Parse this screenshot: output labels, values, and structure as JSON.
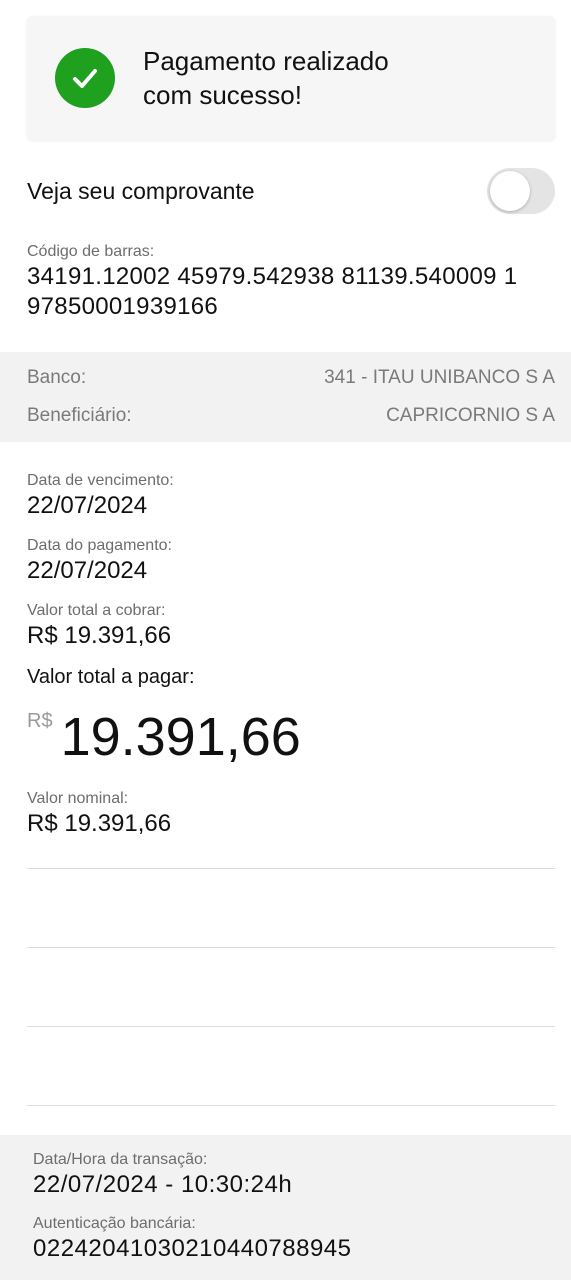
{
  "status": {
    "message": "Pagamento realizado com sucesso!",
    "icon": "check-icon",
    "color": "#1fa01f"
  },
  "receipt": {
    "label": "Veja seu comprovante",
    "toggle_on": false
  },
  "barcode": {
    "label": "Código de barras:",
    "value": "34191.12002 45979.542938 81139.540009 1 97850001939166"
  },
  "bank_info": {
    "bank_label": "Banco:",
    "bank_value": "341 - ITAU UNIBANCO S A",
    "beneficiary_label": "Beneficiário:",
    "beneficiary_value": "CAPRICORNIO S A"
  },
  "details": {
    "due_date_label": "Data de vencimento:",
    "due_date": "22/07/2024",
    "payment_date_label": "Data do pagamento:",
    "payment_date": "22/07/2024",
    "total_charge_label": "Valor total a cobrar:",
    "total_charge": "R$  19.391,66",
    "total_pay_label": "Valor total a pagar:",
    "total_pay_currency": "R$",
    "total_pay_amount": "19.391,66",
    "nominal_label": "Valor nominal:",
    "nominal_value": "R$  19.391,66"
  },
  "transaction": {
    "datetime_label": "Data/Hora da transação:",
    "datetime_value": "22/07/2024 - 10:30:24h",
    "auth_label": "Autenticação bancária:",
    "auth_value": "02242041030210440788945"
  }
}
